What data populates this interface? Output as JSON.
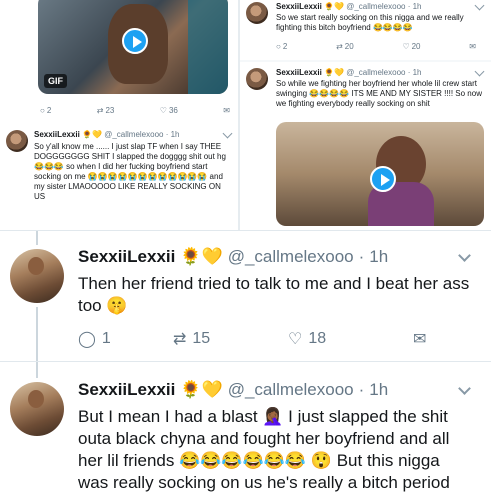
{
  "collage": {
    "top_left": {
      "gif_label": "GIF",
      "replies": "2",
      "retweets": "23",
      "likes": "36"
    },
    "mid_left": {
      "name": "SexxiiLexxii",
      "handle": "@_callmelexooo · 1h",
      "text": "So y'all know me ...... I just slap TF when I say THEE DOGGGGGGG SHIT I slapped the dogggg shit out hg 😂😂😂 so when I did her fucking boyfriend start socking on me 😭😭😭😭😭😭😭😭😭😭😭😭 and my sister LMAOOOOO LIKE REALLY SOCKING ON US"
    },
    "top_right": {
      "name": "SexxiiLexxii",
      "handle": "@_callmelexooo · 1h",
      "text": "So we start really socking on this nigga and we really fighting this bitch boyfriend 😂😂😂😂",
      "replies": "2",
      "retweets": "20",
      "likes": "20"
    },
    "mid_right": {
      "name": "SexxiiLexxii",
      "handle": "@_callmelexooo · 1h",
      "text": "So while we fighting her boyfriend her whole lil crew start swinging 😂😂😂😂 ITS ME AND MY SISTER !!!! So now we fighting everybody really socking on shit"
    }
  },
  "tweet1": {
    "name": "SexxiiLexxii",
    "badges": "🌻💛",
    "handle": "@_callmelexooo",
    "sep": "·",
    "time": "1h",
    "text": "Then her friend tried to talk to me and I beat her ass too 🤫",
    "replies": "1",
    "retweets": "15",
    "likes": "18"
  },
  "tweet2": {
    "name": "SexxiiLexxii",
    "badges": "🌻💛",
    "handle": "@_callmelexooo",
    "sep": "·",
    "time": "1h",
    "text": "But I mean I had a blast 🤦🏾‍♀️ I just slapped the shit outa black chyna and fought her boyfriend and all her lil friends 😂😂😂😂😂😂 😲 But this nigga was really socking on us he's really a bitch period"
  },
  "colors": {
    "text": "#14171a",
    "muted": "#657786",
    "accent": "#1da1f2",
    "divider": "#e1e8ed"
  }
}
